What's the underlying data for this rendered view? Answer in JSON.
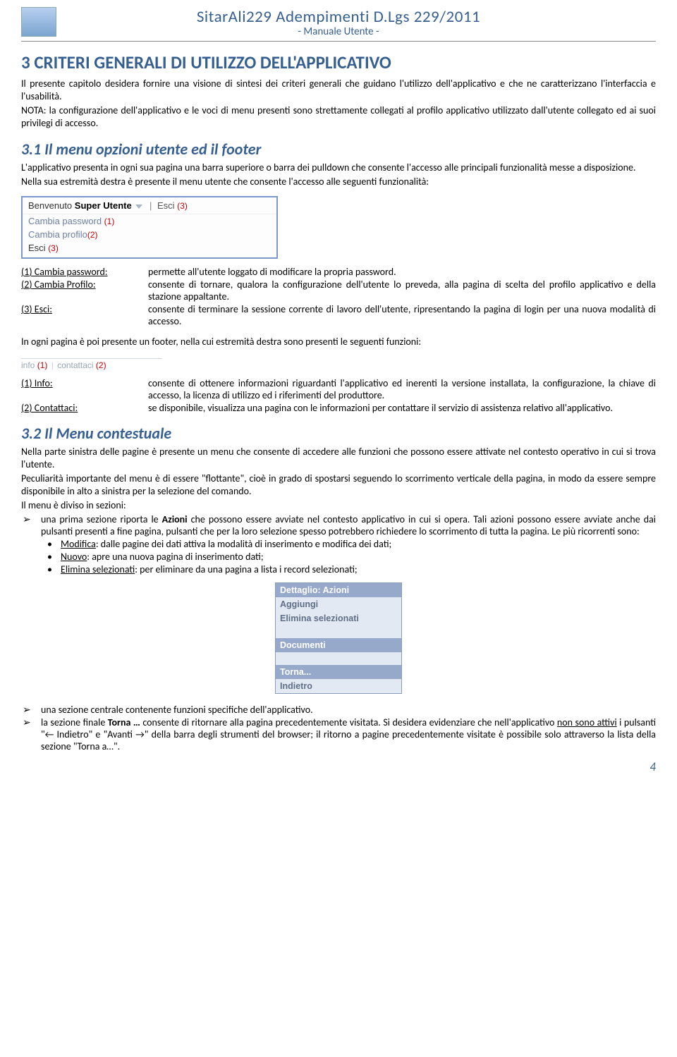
{
  "header": {
    "title": "SitarAli229 Adempimenti D.Lgs 229/2011",
    "subtitle": "- Manuale Utente -"
  },
  "h1": "3   CRITERI GENERALI DI UTILIZZO DELL'APPLICATIVO",
  "intro_p1": "Il presente capitolo desidera fornire una visione di sintesi dei criteri generali che guidano l'utilizzo dell'applicativo e che ne caratterizzano l'interfaccia e l'usabilità.",
  "intro_p2": "NOTA: la configurazione dell'applicativo e le voci di menu presenti sono strettamente collegati al profilo applicativo utilizzato dall'utente collegato ed ai suoi privilegi di accesso.",
  "s31_h": "3.1   Il menu opzioni utente ed il footer",
  "s31_p1": "L'applicativo presenta in ogni sua pagina una barra superiore o barra dei pulldown che consente l'accesso alle principali funzionalità messe a disposizione.",
  "s31_p2": "Nella sua estremità destra è presente il menu utente che consente l'accesso alle seguenti funzionalità:",
  "um": {
    "welcome": "Benvenuto",
    "user": "Super Utente",
    "esci": "Esci",
    "n3a": "(3)",
    "row1": "Cambia password",
    "n1": "(1)",
    "row2": "Cambia profilo",
    "n2": "(2)",
    "row3": "Esci",
    "n3b": "(3)"
  },
  "defs1": [
    {
      "label": "(1) Cambia password:",
      "text": "permette all'utente loggato di modificare la propria password."
    },
    {
      "label": "(2) Cambia Profilo:",
      "text": "consente di tornare, qualora la configurazione dell'utente lo preveda, alla pagina di scelta del profilo applicativo e della stazione appaltante."
    },
    {
      "label": "(3) Esci:",
      "text": "consente di terminare la sessione corrente di lavoro dell'utente, ripresentando la pagina di login per una nuova modalità di accesso."
    }
  ],
  "footer_line": "In ogni pagina è poi presente un footer, nella cui estremità destra sono presenti le seguenti funzioni:",
  "footer_img": {
    "info": "info",
    "n1": "(1)",
    "contattaci": "contattaci",
    "n2": "(2)"
  },
  "defs2": [
    {
      "label": "(1) Info:",
      "text": "consente di ottenere informazioni riguardanti l'applicativo ed inerenti la versione installata, la configurazione, la chiave di accesso, la licenza di utilizzo ed i riferimenti del produttore."
    },
    {
      "label": "(2) Contattaci:",
      "text": "se disponibile, visualizza una pagina con le informazioni per contattare il servizio di assistenza relativo all'applicativo."
    }
  ],
  "s32_h": "3.2   Il Menu contestuale",
  "s32_p1": "Nella parte sinistra delle pagine è presente un menu che consente di accedere alle funzioni che possono essere attivate nel contesto operativo in cui si trova l'utente.",
  "s32_p2": "Peculiarità importante del menu è di essere \"flottante\", cioè in grado di spostarsi seguendo lo scorrimento verticale della pagina, in modo da essere sempre disponibile in alto a sinistra per la selezione del comando.",
  "s32_p3": "Il menu è diviso in sezioni:",
  "s32_b1_pre": "una prima sezione riporta le ",
  "s32_b1_bold": "Azioni",
  "s32_b1_post": " che possono essere avviate nel contesto applicativo in cui si opera. Tali azioni possono essere avviate anche dai pulsanti presenti a fine pagina, pulsanti che per la loro selezione spesso potrebbero richiedere lo scorrimento di tutta la pagina. Le più ricorrenti sono:",
  "s32_sub": [
    {
      "u": "Modifica",
      "rest": ": dalle pagine dei dati attiva la modalità di inserimento e modifica dei dati;"
    },
    {
      "u": "Nuovo",
      "rest": ": apre una nuova pagina di inserimento dati;"
    },
    {
      "u": "Elimina selezionati",
      "rest": ": per eliminare da una pagina a lista i record selezionati;"
    }
  ],
  "ctx": {
    "h1": "Dettaglio: Azioni",
    "r1": "Aggiungi",
    "r2": "Elimina selezionati",
    "h2": "Documenti",
    "h3": "Torna...",
    "r3": "Indietro"
  },
  "s32_b2": "una sezione centrale contenente funzioni specifiche dell'applicativo.",
  "s32_b3_pre": "la sezione finale ",
  "s32_b3_bold": "Torna …",
  "s32_b3_mid": " consente di ritornare alla pagina precedentemente visitata. Si desidera evidenziare che nell'applicativo ",
  "s32_b3_u": "non sono attivi",
  "s32_b3_post1": " i pulsanti \"← Indietro\" e \"Avanti →\" della barra degli strumenti del browser; il ritorno a pagine precedentemente visitate è possibile solo attraverso la lista della sezione \"Torna a…\".",
  "page_num": "4"
}
